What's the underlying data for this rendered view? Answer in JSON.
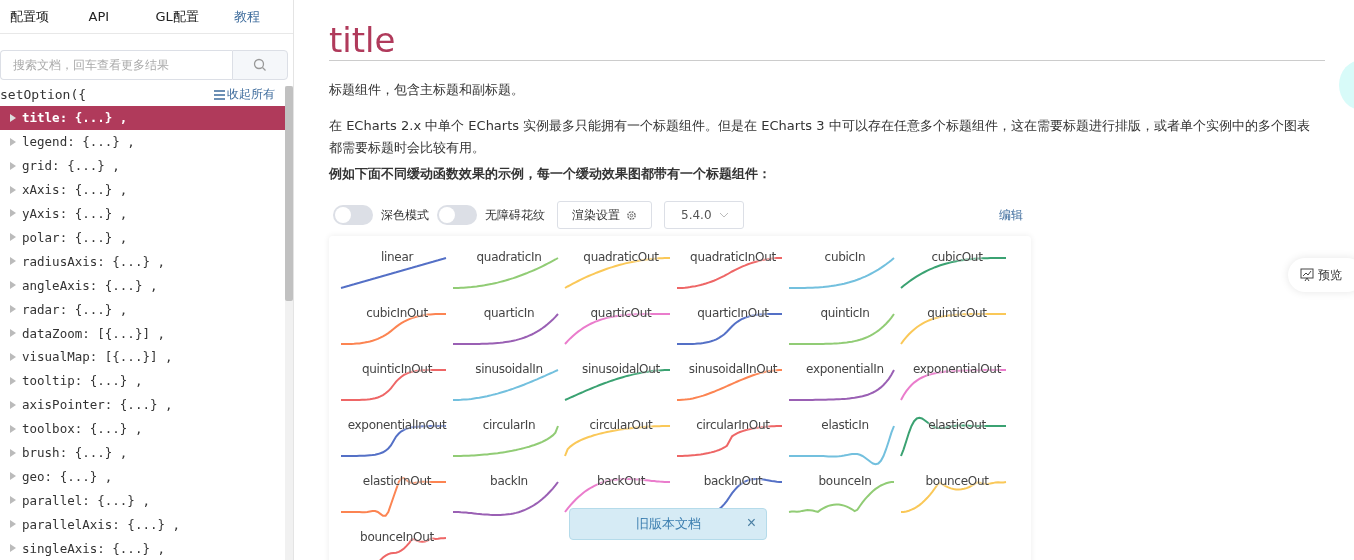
{
  "nav_tabs": [
    {
      "label": "配置项",
      "selected": false
    },
    {
      "label": "API",
      "selected": false
    },
    {
      "label": "GL配置",
      "selected": false
    },
    {
      "label": "教程",
      "selected": true
    }
  ],
  "search": {
    "placeholder": "搜索文档，回车查看更多结果"
  },
  "tree": {
    "root": "setOption({",
    "collapse_all": "收起所有",
    "items": [
      {
        "label": "title: {...} ,",
        "selected": true
      },
      {
        "label": "legend: {...} ,",
        "selected": false
      },
      {
        "label": "grid: {...} ,",
        "selected": false
      },
      {
        "label": "xAxis: {...} ,",
        "selected": false
      },
      {
        "label": "yAxis: {...} ,",
        "selected": false
      },
      {
        "label": "polar: {...} ,",
        "selected": false
      },
      {
        "label": "radiusAxis: {...} ,",
        "selected": false
      },
      {
        "label": "angleAxis: {...} ,",
        "selected": false
      },
      {
        "label": "radar: {...} ,",
        "selected": false
      },
      {
        "label": "dataZoom: [{...}] ,",
        "selected": false
      },
      {
        "label": "visualMap: [{...}] ,",
        "selected": false
      },
      {
        "label": "tooltip: {...} ,",
        "selected": false
      },
      {
        "label": "axisPointer: {...} ,",
        "selected": false
      },
      {
        "label": "toolbox: {...} ,",
        "selected": false
      },
      {
        "label": "brush: {...} ,",
        "selected": false
      },
      {
        "label": "geo: {...} ,",
        "selected": false
      },
      {
        "label": "parallel: {...} ,",
        "selected": false
      },
      {
        "label": "parallelAxis: {...} ,",
        "selected": false
      },
      {
        "label": "singleAxis: {...} ,",
        "selected": false
      }
    ]
  },
  "doc": {
    "title": "title",
    "paragraphs": [
      "标题组件，包含主标题和副标题。",
      "在 ECharts 2.x 中单个 ECharts 实例最多只能拥有一个标题组件。但是在 ECharts 3 中可以存在任意多个标题组件，这在需要标题进行排版，或者单个实例中的多个图表都需要标题时会比较有用。"
    ],
    "example_heading": "例如下面不同缓动函数效果的示例，每一个缓动效果图都带有一个标题组件："
  },
  "toolbar": {
    "switches": [
      {
        "label": "深色模式",
        "on": false
      },
      {
        "label": "无障碍花纹",
        "on": false
      }
    ],
    "render_button": "渲染设置",
    "version": "5.4.0",
    "edit_link": "编辑"
  },
  "easings": [
    {
      "label": "linear",
      "color": "#5470c6"
    },
    {
      "label": "quadraticIn",
      "color": "#91cc75"
    },
    {
      "label": "quadraticOut",
      "color": "#fac858"
    },
    {
      "label": "quadraticInOut",
      "color": "#ee6666"
    },
    {
      "label": "cubicIn",
      "color": "#73c0de"
    },
    {
      "label": "cubicOut",
      "color": "#3ba272"
    },
    {
      "label": "cubicInOut",
      "color": "#fc8452"
    },
    {
      "label": "quarticIn",
      "color": "#9a60b4"
    },
    {
      "label": "quarticOut",
      "color": "#ea7ccc"
    },
    {
      "label": "quarticInOut",
      "color": "#5470c6"
    },
    {
      "label": "quinticIn",
      "color": "#91cc75"
    },
    {
      "label": "quinticOut",
      "color": "#fac858"
    },
    {
      "label": "quinticInOut",
      "color": "#ee6666"
    },
    {
      "label": "sinusoidalIn",
      "color": "#73c0de"
    },
    {
      "label": "sinusoidalOut",
      "color": "#3ba272"
    },
    {
      "label": "sinusoidalInOut",
      "color": "#fc8452"
    },
    {
      "label": "exponentialIn",
      "color": "#9a60b4"
    },
    {
      "label": "exponentialOut",
      "color": "#ea7ccc"
    },
    {
      "label": "exponentialInOut",
      "color": "#5470c6"
    },
    {
      "label": "circularIn",
      "color": "#91cc75"
    },
    {
      "label": "circularOut",
      "color": "#fac858"
    },
    {
      "label": "circularInOut",
      "color": "#ee6666"
    },
    {
      "label": "elasticIn",
      "color": "#73c0de"
    },
    {
      "label": "elasticOut",
      "color": "#3ba272"
    },
    {
      "label": "elasticInOut",
      "color": "#fc8452"
    },
    {
      "label": "backIn",
      "color": "#9a60b4"
    },
    {
      "label": "backOut",
      "color": "#ea7ccc"
    },
    {
      "label": "backInOut",
      "color": "#5470c6"
    },
    {
      "label": "bounceIn",
      "color": "#91cc75"
    },
    {
      "label": "bounceOut",
      "color": "#fac858"
    },
    {
      "label": "bounceInOut",
      "color": "#ee6666"
    }
  ],
  "notice": {
    "text": "旧版本文档",
    "close": "×"
  },
  "preview_button": "预览"
}
